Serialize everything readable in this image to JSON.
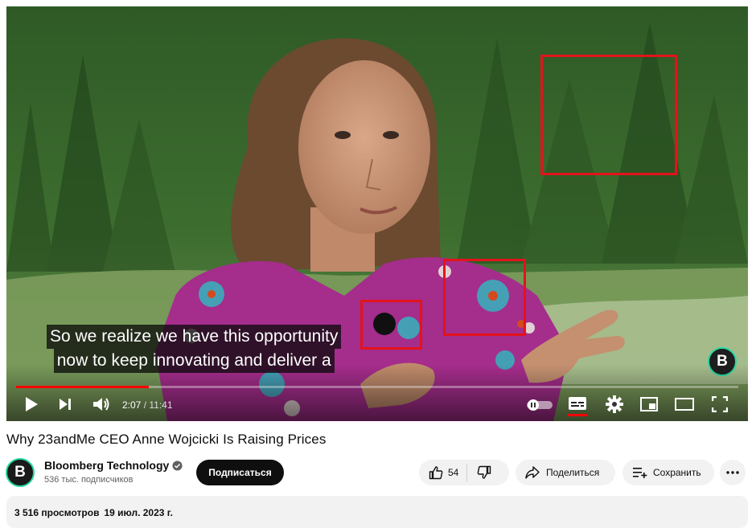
{
  "player": {
    "captions": [
      "So we realize we have this opportunity",
      "now to keep innovating and deliver a"
    ],
    "watermark_letter": "B",
    "progress_fraction": 0.184,
    "time_current": "2:07",
    "time_separator": " / ",
    "time_total": "11:41",
    "subtitles_active": true,
    "accent_color": "#ff0000",
    "annotation_color": "#e3131b",
    "icons": [
      "play-icon",
      "next-icon",
      "volume-icon",
      "autoplay-toggle-icon",
      "subtitles-icon",
      "settings-icon",
      "miniplayer-icon",
      "theater-mode-icon",
      "fullscreen-icon"
    ]
  },
  "video": {
    "title": "Why 23andMe CEO Anne Wojcicki Is Raising Prices"
  },
  "channel": {
    "avatar_letter": "B",
    "name": "Bloomberg Technology",
    "verified": true,
    "subscribers": "536 тыс. подписчиков",
    "brand_color": "#27d8a4"
  },
  "actions": {
    "subscribe_label": "Подписаться",
    "like_count": "54",
    "share_label": "Поделиться",
    "save_label": "Сохранить",
    "icons": [
      "thumbs-up-icon",
      "thumbs-down-icon",
      "share-arrow-icon",
      "save-playlist-icon",
      "more-icon"
    ]
  },
  "description": {
    "views": "3 516 просмотров",
    "date": "19 июл. 2023 г."
  }
}
